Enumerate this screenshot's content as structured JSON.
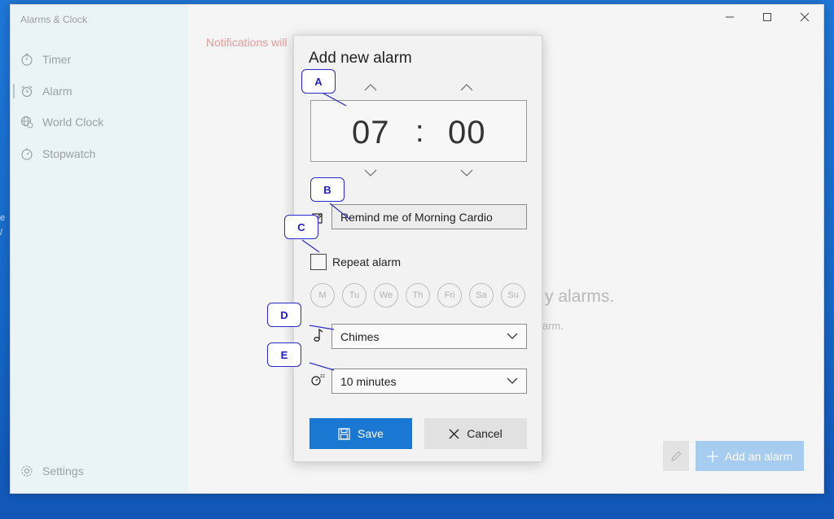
{
  "app": {
    "title": "Alarms & Clock",
    "window_controls": [
      "minimize-icon",
      "maximize-icon",
      "close-icon"
    ]
  },
  "sidebar": {
    "items": [
      {
        "label": "Timer",
        "icon": "timer-icon",
        "active": false
      },
      {
        "label": "Alarm",
        "icon": "alarm-clock-icon",
        "active": true
      },
      {
        "label": "World Clock",
        "icon": "globe-clock-icon",
        "active": false
      },
      {
        "label": "Stopwatch",
        "icon": "stopwatch-icon",
        "active": false
      }
    ],
    "settings_label": "Settings"
  },
  "background": {
    "notification_text": "Notifications will",
    "empty_title": "y alarms.",
    "empty_sub": "larm.",
    "add_alarm_label": "Add an alarm"
  },
  "dialog": {
    "title": "Add new alarm",
    "hour": "07",
    "separator": ":",
    "minute": "00",
    "alarm_name": "Remind me of Morning Cardio",
    "repeat_label": "Repeat alarm",
    "repeat_checked": false,
    "days": [
      "M",
      "Tu",
      "We",
      "Th",
      "Fri",
      "Sa",
      "Su"
    ],
    "sound": "Chimes",
    "snooze": "10 minutes",
    "save_label": "Save",
    "cancel_label": "Cancel"
  },
  "annotations": [
    "A",
    "B",
    "C",
    "D",
    "E"
  ],
  "colors": {
    "accent": "#1a78d2",
    "callout": "#1c1ccc",
    "notification": "#e89a9a"
  }
}
